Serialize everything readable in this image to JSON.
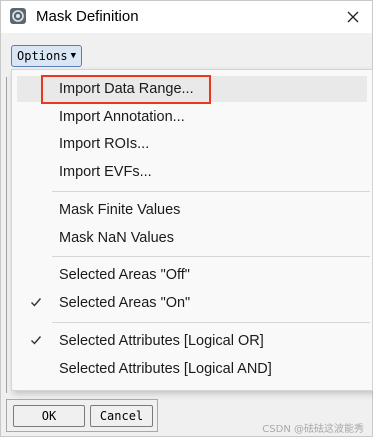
{
  "window": {
    "title": "Mask Definition"
  },
  "options_button": {
    "label": "Options",
    "caret": "▼"
  },
  "menu": {
    "items": [
      {
        "label": "Import Data Range...",
        "checked": false,
        "hovered": true
      },
      {
        "label": "Import Annotation...",
        "checked": false
      },
      {
        "label": "Import ROIs...",
        "checked": false
      },
      {
        "label": "Import EVFs...",
        "checked": false
      },
      {
        "label": "Mask Finite Values",
        "checked": false
      },
      {
        "label": "Mask NaN Values",
        "checked": false
      },
      {
        "label": "Selected Areas \"Off\"",
        "checked": false
      },
      {
        "label": "Selected Areas \"On\"",
        "checked": true
      },
      {
        "label": "Selected Attributes [Logical OR]",
        "checked": true
      },
      {
        "label": "Selected Attributes [Logical AND]",
        "checked": false
      }
    ]
  },
  "footer": {
    "ok_label": "OK",
    "cancel_label": "Cancel"
  },
  "watermark": "CSDN @砝砝这波能秀",
  "colors": {
    "highlight_border": "#e8391e",
    "options_bg": "#dbe6f5",
    "options_border": "#5a7fb5"
  },
  "icons": {
    "app": "idl-app-icon",
    "close": "close-icon",
    "check": "checkmark-icon"
  }
}
